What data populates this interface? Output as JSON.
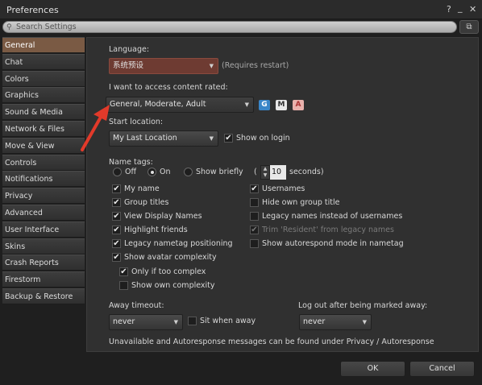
{
  "window": {
    "title": "Preferences",
    "help_icon": "?",
    "minimize_icon": "_",
    "close_icon": "✕"
  },
  "search": {
    "placeholder": "Search Settings"
  },
  "sidebar": {
    "items": [
      {
        "label": "General",
        "active": true
      },
      {
        "label": "Chat"
      },
      {
        "label": "Colors"
      },
      {
        "label": "Graphics"
      },
      {
        "label": "Sound & Media"
      },
      {
        "label": "Network & Files"
      },
      {
        "label": "Move & View"
      },
      {
        "label": "Controls"
      },
      {
        "label": "Notifications"
      },
      {
        "label": "Privacy"
      },
      {
        "label": "Advanced"
      },
      {
        "label": "User Interface"
      },
      {
        "label": "Skins"
      },
      {
        "label": "Crash Reports"
      },
      {
        "label": "Firestorm"
      },
      {
        "label": "Backup & Restore"
      }
    ]
  },
  "general": {
    "language_label": "Language:",
    "language_value": "系统预设",
    "language_note": "(Requires restart)",
    "maturity_label": "I want to access content rated:",
    "maturity_value": "General, Moderate, Adult",
    "badges": {
      "g": "G",
      "m": "M",
      "a": "A"
    },
    "start_label": "Start location:",
    "start_value": "My Last Location",
    "show_on_login": "Show on login",
    "name_tags_label": "Name tags:",
    "radio_off": "Off",
    "radio_on": "On",
    "radio_show_briefly": "Show briefly",
    "briefly_open_paren": "(",
    "briefly_value": "10",
    "briefly_units": "seconds)",
    "left_checks": [
      {
        "label": "My name",
        "checked": true
      },
      {
        "label": "Group titles",
        "checked": true
      },
      {
        "label": "View Display Names",
        "checked": true
      },
      {
        "label": "Highlight friends",
        "checked": true
      },
      {
        "label": "Legacy nametag positioning",
        "checked": true
      },
      {
        "label": "Show avatar complexity",
        "checked": true
      },
      {
        "label": "Only if too complex",
        "checked": true
      },
      {
        "label": "Show own complexity",
        "checked": false
      }
    ],
    "right_checks": [
      {
        "label": "Usernames",
        "checked": true
      },
      {
        "label": "Hide own group title",
        "checked": false
      },
      {
        "label": "Legacy names instead of usernames",
        "checked": false
      },
      {
        "label": "Trim 'Resident' from legacy names",
        "checked": true,
        "disabled": true
      },
      {
        "label": "Show autorespond mode in nametag",
        "checked": false
      }
    ],
    "away_label": "Away timeout:",
    "away_value": "never",
    "sit_when_away": "Sit when away",
    "logout_label": "Log out after being marked away:",
    "logout_value": "never",
    "info_text": "Unavailable and Autoresponse messages can be found under Privacy / Autoresponse"
  },
  "footer": {
    "ok": "OK",
    "cancel": "Cancel"
  },
  "colors": {
    "accent": "#7a5a44",
    "arrow": "#e23a2a",
    "badge_g": "#3a86c8",
    "badge_m": "#e8e8e8",
    "badge_a": "#e9b1ac"
  }
}
